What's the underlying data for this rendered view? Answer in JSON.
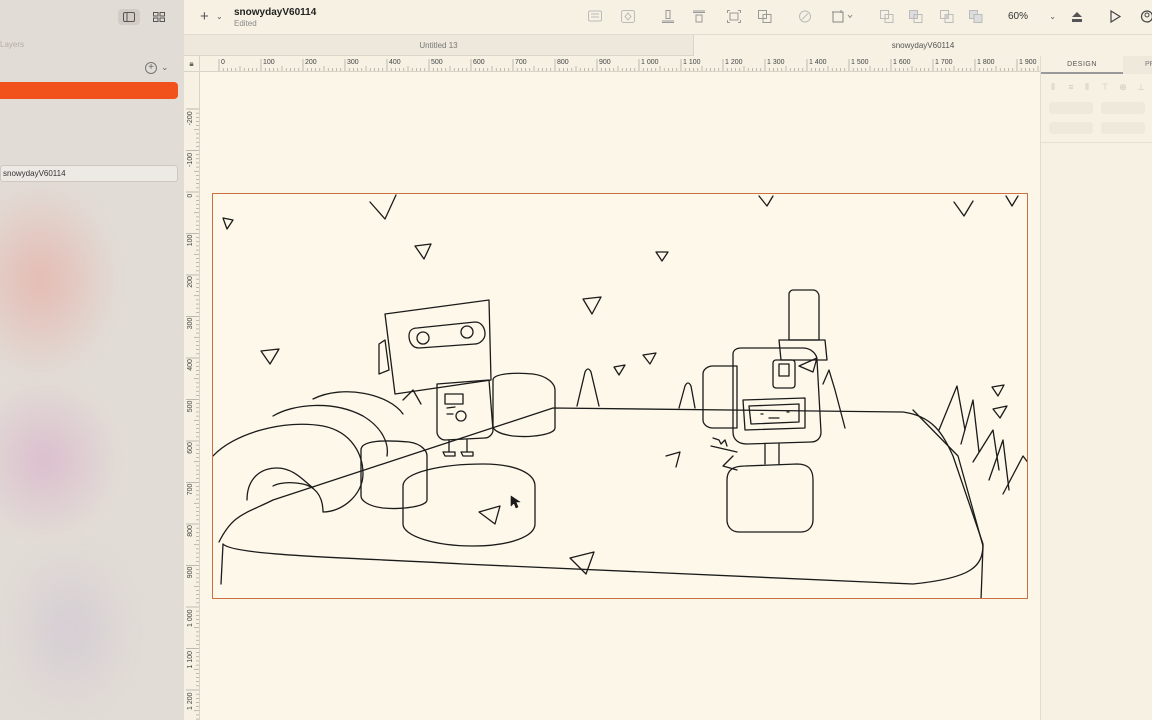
{
  "sidebar": {
    "layers_label": "Layers",
    "artboard_item": "snowydayV60114"
  },
  "toolbar": {
    "add_symbol": "+",
    "document_title": "snowydayV60114",
    "document_status": "Edited",
    "zoom_level": "60%"
  },
  "tabs": [
    {
      "label": "Untitled 13"
    },
    {
      "label": "snowydayV60114"
    }
  ],
  "ruler": {
    "top_ticks": [
      "0",
      "100",
      "200",
      "300",
      "400",
      "500",
      "600",
      "700",
      "800",
      "900",
      "1 000",
      "1 100",
      "1 200",
      "1 300",
      "1 400",
      "1 500",
      "1 600",
      "1 700",
      "1 800",
      "1 900"
    ],
    "left_ticks": [
      "-200",
      "-100",
      "0",
      "100",
      "200",
      "300",
      "400",
      "500",
      "600",
      "700",
      "800",
      "900",
      "1 000",
      "1 100",
      "1 200"
    ]
  },
  "inspector": {
    "design_tab": "DESIGN",
    "prototype_tab": "PR"
  },
  "colors": {
    "accent": "#f1511b",
    "artboard_border": "#c8703f",
    "canvas_bg": "#fbf6e8"
  }
}
